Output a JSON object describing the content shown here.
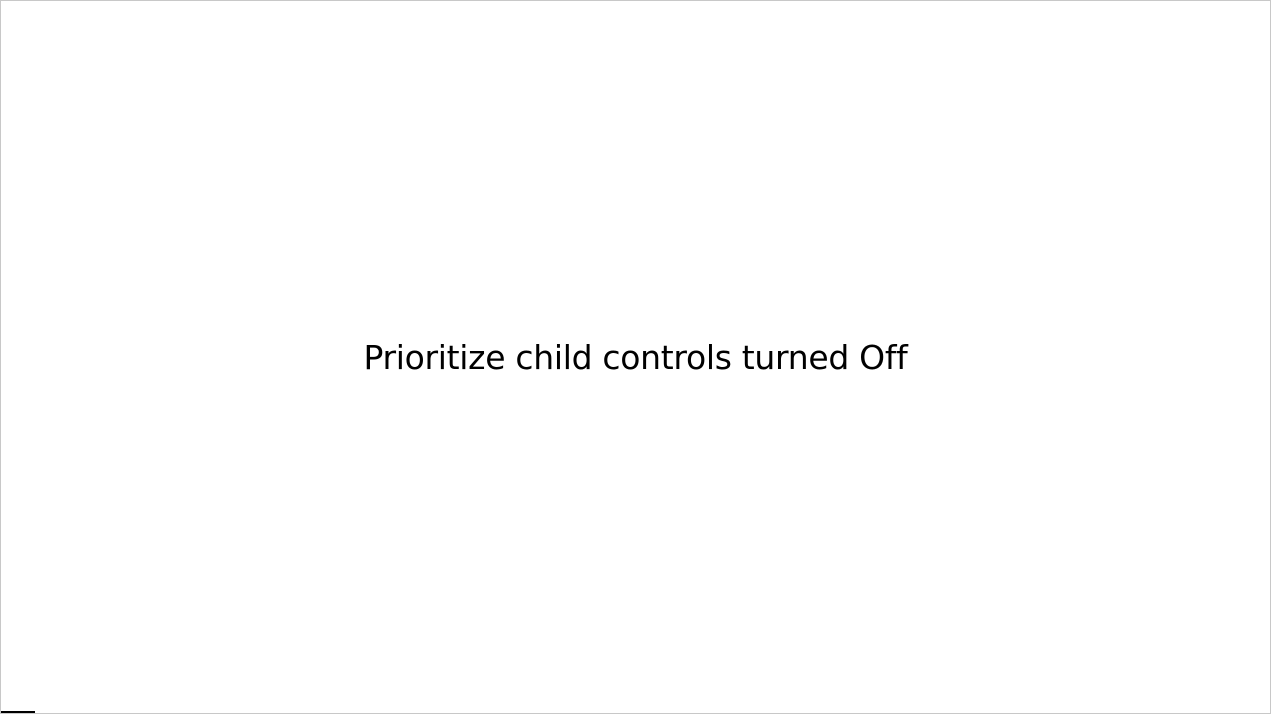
{
  "message": {
    "text": "Prioritize child controls turned Off",
    "color": "#000000"
  },
  "window": {
    "background": "#ffffff",
    "border_color": "#c8c8c8"
  }
}
